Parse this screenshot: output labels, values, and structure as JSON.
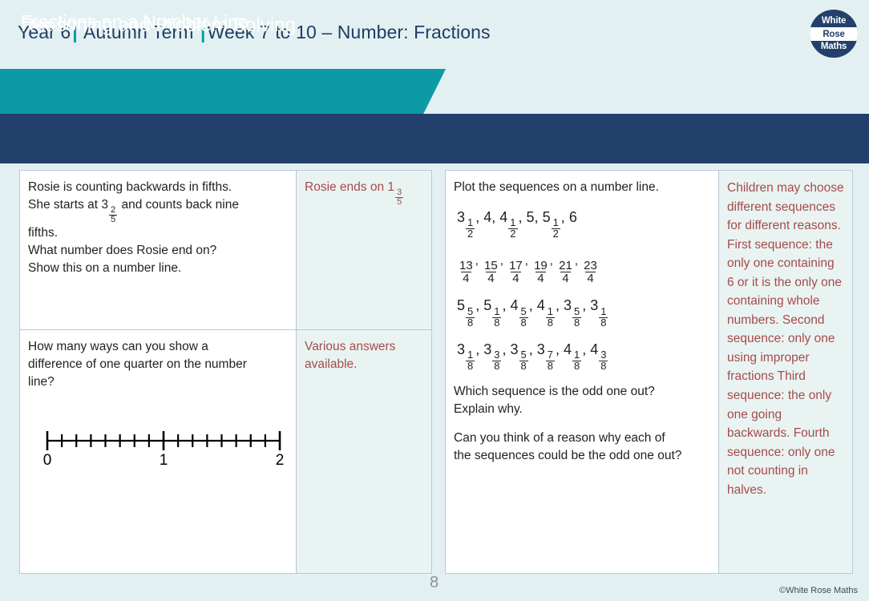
{
  "header": {
    "year": "Year 6",
    "term": "Autumn Term",
    "week": "Week 7 to 10 – Number: Fractions",
    "separator": "|"
  },
  "logo": {
    "line1": "White",
    "line2": "Rose",
    "line3": "Maths"
  },
  "banners": {
    "lesson_title": "Fractions on a Number Line",
    "section_title": "Reasoning and Problem Solving",
    "teal_color": "#0b9aa6",
    "navy_color": "#22406b"
  },
  "left_panel": {
    "q1": {
      "line1": "Rosie is counting backwards in fifths.",
      "line2_a": "She starts at 3",
      "line2_frac_num": "2",
      "line2_frac_den": "5",
      "line2_b": " and counts back nine",
      "line3": "fifths.",
      "line4": "What number does Rosie end on?",
      "line5": "Show this on a number line."
    },
    "a1": {
      "text": "Rosie ends on 1",
      "frac_num": "3",
      "frac_den": "5"
    },
    "q2": {
      "line1": "How many ways can you show a",
      "line2": "difference of one quarter on the number",
      "line3": "line?"
    },
    "a2": {
      "line1": "Various answers",
      "line2": "available."
    }
  },
  "number_line": {
    "start_label": "0",
    "mid_label": "1",
    "end_label": "2",
    "min": 0,
    "max": 2,
    "intervals": 16,
    "major_every": 8
  },
  "right_panel": {
    "prompt": "Plot the sequences on a number line.",
    "sequences": [
      {
        "id": "sequence-1",
        "style": "mixed",
        "terms": [
          {
            "whole": "3",
            "num": "1",
            "den": "2"
          },
          {
            "whole": "4"
          },
          {
            "whole": "4",
            "num": "1",
            "den": "2"
          },
          {
            "whole": "5"
          },
          {
            "whole": "5",
            "num": "1",
            "den": "2"
          },
          {
            "whole": "6"
          }
        ]
      },
      {
        "id": "sequence-2",
        "style": "improper",
        "terms": [
          {
            "num": "13",
            "den": "4"
          },
          {
            "num": "15",
            "den": "4"
          },
          {
            "num": "17",
            "den": "4"
          },
          {
            "num": "19",
            "den": "4"
          },
          {
            "num": "21",
            "den": "4"
          },
          {
            "num": "23",
            "den": "4"
          }
        ]
      },
      {
        "id": "sequence-3",
        "style": "mixed",
        "terms": [
          {
            "whole": "5",
            "num": "5",
            "den": "8"
          },
          {
            "whole": "5",
            "num": "1",
            "den": "8"
          },
          {
            "whole": "4",
            "num": "5",
            "den": "8"
          },
          {
            "whole": "4",
            "num": "1",
            "den": "8"
          },
          {
            "whole": "3",
            "num": "5",
            "den": "8"
          },
          {
            "whole": "3",
            "num": "1",
            "den": "8"
          }
        ]
      },
      {
        "id": "sequence-4",
        "style": "mixed",
        "terms": [
          {
            "whole": "3",
            "num": "1",
            "den": "8"
          },
          {
            "whole": "3",
            "num": "3",
            "den": "8"
          },
          {
            "whole": "3",
            "num": "5",
            "den": "8"
          },
          {
            "whole": "3",
            "num": "7",
            "den": "8"
          },
          {
            "whole": "4",
            "num": "1",
            "den": "8"
          },
          {
            "whole": "4",
            "num": "3",
            "den": "8"
          }
        ]
      }
    ],
    "question1_line1": "Which sequence is the odd one out?",
    "question1_line2": "Explain why.",
    "question2_line1": "Can you think of a reason why each of",
    "question2_line2": "the sequences could be the odd one out?",
    "answer": "Children may choose different sequences for different reasons. First sequence: the only one containing 6 or it is the only one containing whole numbers. Second sequence: only one using improper fractions Third sequence: the only one going backwards. Fourth sequence: only one not counting in halves."
  },
  "footer": {
    "page_number": "8",
    "copyright": "©White Rose Maths"
  },
  "colors": {
    "answer_text": "#a64a4a",
    "answer_bg": "#e9f4f2",
    "border": "#b9c9d3",
    "body_text": "#231f20"
  }
}
